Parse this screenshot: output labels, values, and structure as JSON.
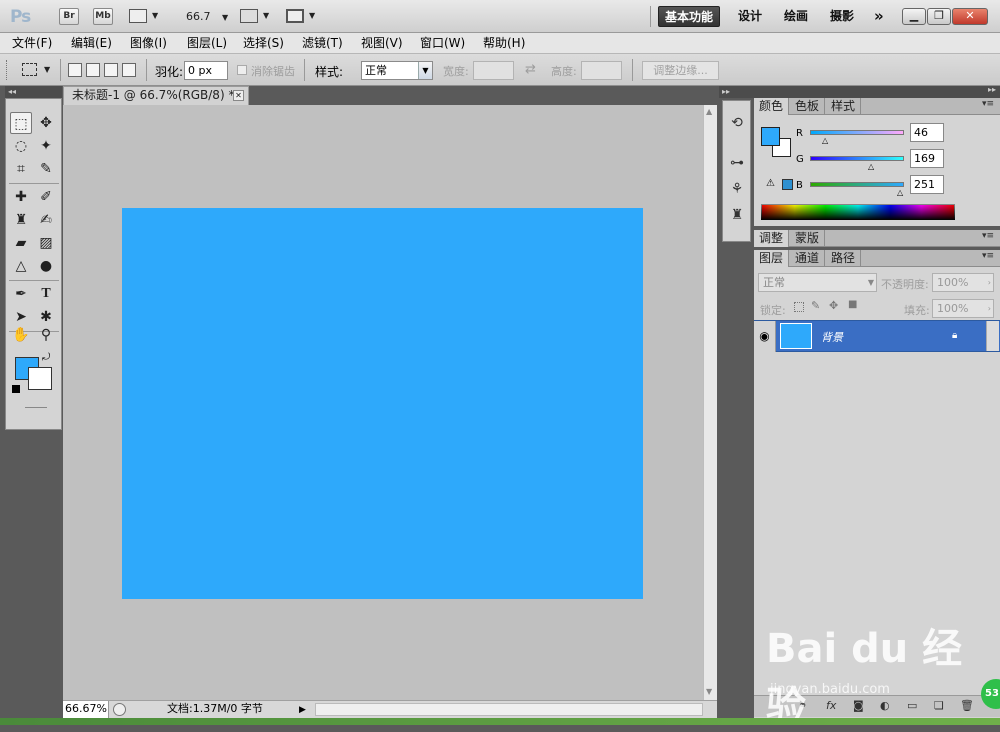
{
  "app": {
    "logo": "Ps",
    "bridge": "Br",
    "minibridge": "Mb",
    "zoom": "66.7"
  },
  "workspaces": [
    "基本功能",
    "设计",
    "绘画",
    "摄影",
    "»"
  ],
  "menu": [
    "文件(F)",
    "编辑(E)",
    "图像(I)",
    "图层(L)",
    "选择(S)",
    "滤镜(T)",
    "视图(V)",
    "窗口(W)",
    "帮助(H)"
  ],
  "options": {
    "feather_label": "羽化:",
    "feather_value": "0 px",
    "antialias_label": "消除锯齿",
    "style_label": "样式:",
    "style_value": "正常",
    "width_label": "宽度:",
    "height_label": "高度:",
    "refine_edge": "调整边缘..."
  },
  "document": {
    "tab_title": "未标题-1 @ 66.7%(RGB/8) *",
    "fill_color": "#2ea9fb"
  },
  "status": {
    "zoom": "66.67%",
    "doc_info": "文档:1.37M/0 字节"
  },
  "color_panel": {
    "tabs": [
      "颜色",
      "色板",
      "样式"
    ],
    "channels": [
      {
        "name": "R",
        "value": "46"
      },
      {
        "name": "G",
        "value": "169"
      },
      {
        "name": "B",
        "value": "251"
      }
    ],
    "foreground": "#2ea9fb"
  },
  "adjust_panel": {
    "tabs": [
      "调整",
      "蒙版"
    ]
  },
  "layers_panel": {
    "tabs": [
      "图层",
      "通道",
      "路径"
    ],
    "blend_mode": "正常",
    "opacity_label": "不透明度:",
    "opacity_value": "100%",
    "lock_label": "锁定:",
    "fill_label": "填充:",
    "fill_value": "100%",
    "layers": [
      {
        "name": "背景",
        "locked": true,
        "visible": true
      }
    ]
  },
  "watermark": {
    "text": "Bai du 经验",
    "url": "jingyan.baidu.com",
    "badge": "53"
  }
}
